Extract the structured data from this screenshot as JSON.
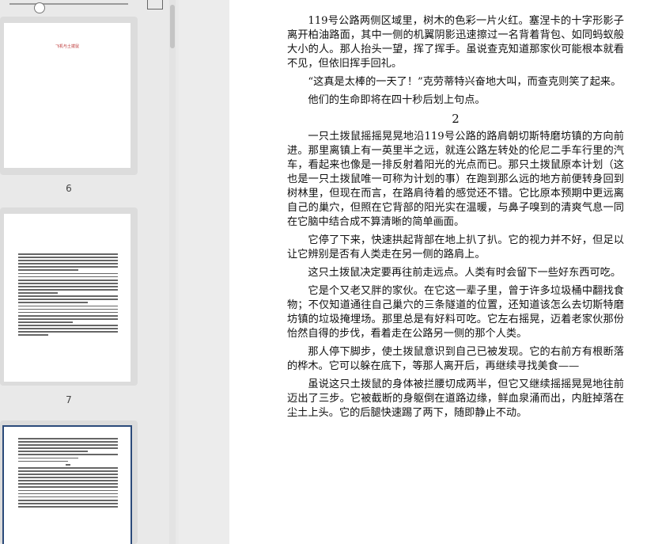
{
  "sidebar": {
    "thumbnails": [
      {
        "page_number": "6",
        "title": "飞机与土拨鼠"
      },
      {
        "page_number": "7"
      },
      {
        "page_number": ""
      }
    ]
  },
  "page": {
    "paragraphs_before": [
      "119号公路两侧区域里，树木的色彩一片火红。塞涅卡的十字形影子离开柏油路面，其中一侧的机翼阴影迅速擦过一名背着背包、如同蚂蚁般大小的人。那人抬头一望，挥了挥手。虽说查克知道那家伙可能根本就看不见，但依旧挥手回礼。",
      "“这真是太棒的一天了！”克劳蒂特兴奋地大叫，而查克则笑了起来。",
      "他们的生命即将在四十秒后划上句点。"
    ],
    "chapter_number": "2",
    "paragraphs_after": [
      "一只土拨鼠摇摇晃晃地沿119号公路的路肩朝切斯特磨坊镇的方向前进。那里离镇上有一英里半之远，就连公路左转处的伦尼二手车行里的汽车，看起来也像是一排反射着阳光的光点而已。那只土拨鼠原本计划（这也是一只土拨鼠唯一可称为计划的事）在跑到那么远的地方前便转身回到树林里，但现在而言，在路肩待着的感觉还不错。它比原本预期中更远离自己的巢穴，但照在它背部的阳光实在温暖，与鼻子嗅到的清爽气息一同在它脑中结合成不算清晰的简单画面。",
      "它停了下来，快速拱起背部在地上扒了扒。它的视力并不好，但足以让它辨别是否有人类走在另一侧的路肩上。",
      "这只土拨鼠决定要再往前走远点。人类有时会留下一些好东西可吃。",
      "它是个又老又胖的家伙。在它这一辈子里，曾于许多垃圾桶中翻找食物；不仅知道通往自己巢穴的三条隧道的位置，还知道该怎么去切斯特磨坊镇的垃圾掩埋场。那里总是有好料可吃。它左右摇晃，迈着老家伙那份怡然自得的步伐，看着走在公路另一侧的那个人类。",
      "那人停下脚步，使土拨鼠意识到自己已被发现。它的右前方有根断落的桦木。它可以躲在底下，等那人离开后，再继续寻找美食——",
      "虽说这只土拨鼠的身体被拦腰切成两半，但它又继续摇摇晃晃地往前迈出了三步。它被截断的身躯倒在道路边缘，鲜血泉涌而出，内脏掉落在尘土上头。它的后腿快速踢了两下，随即静止不动。"
    ]
  }
}
